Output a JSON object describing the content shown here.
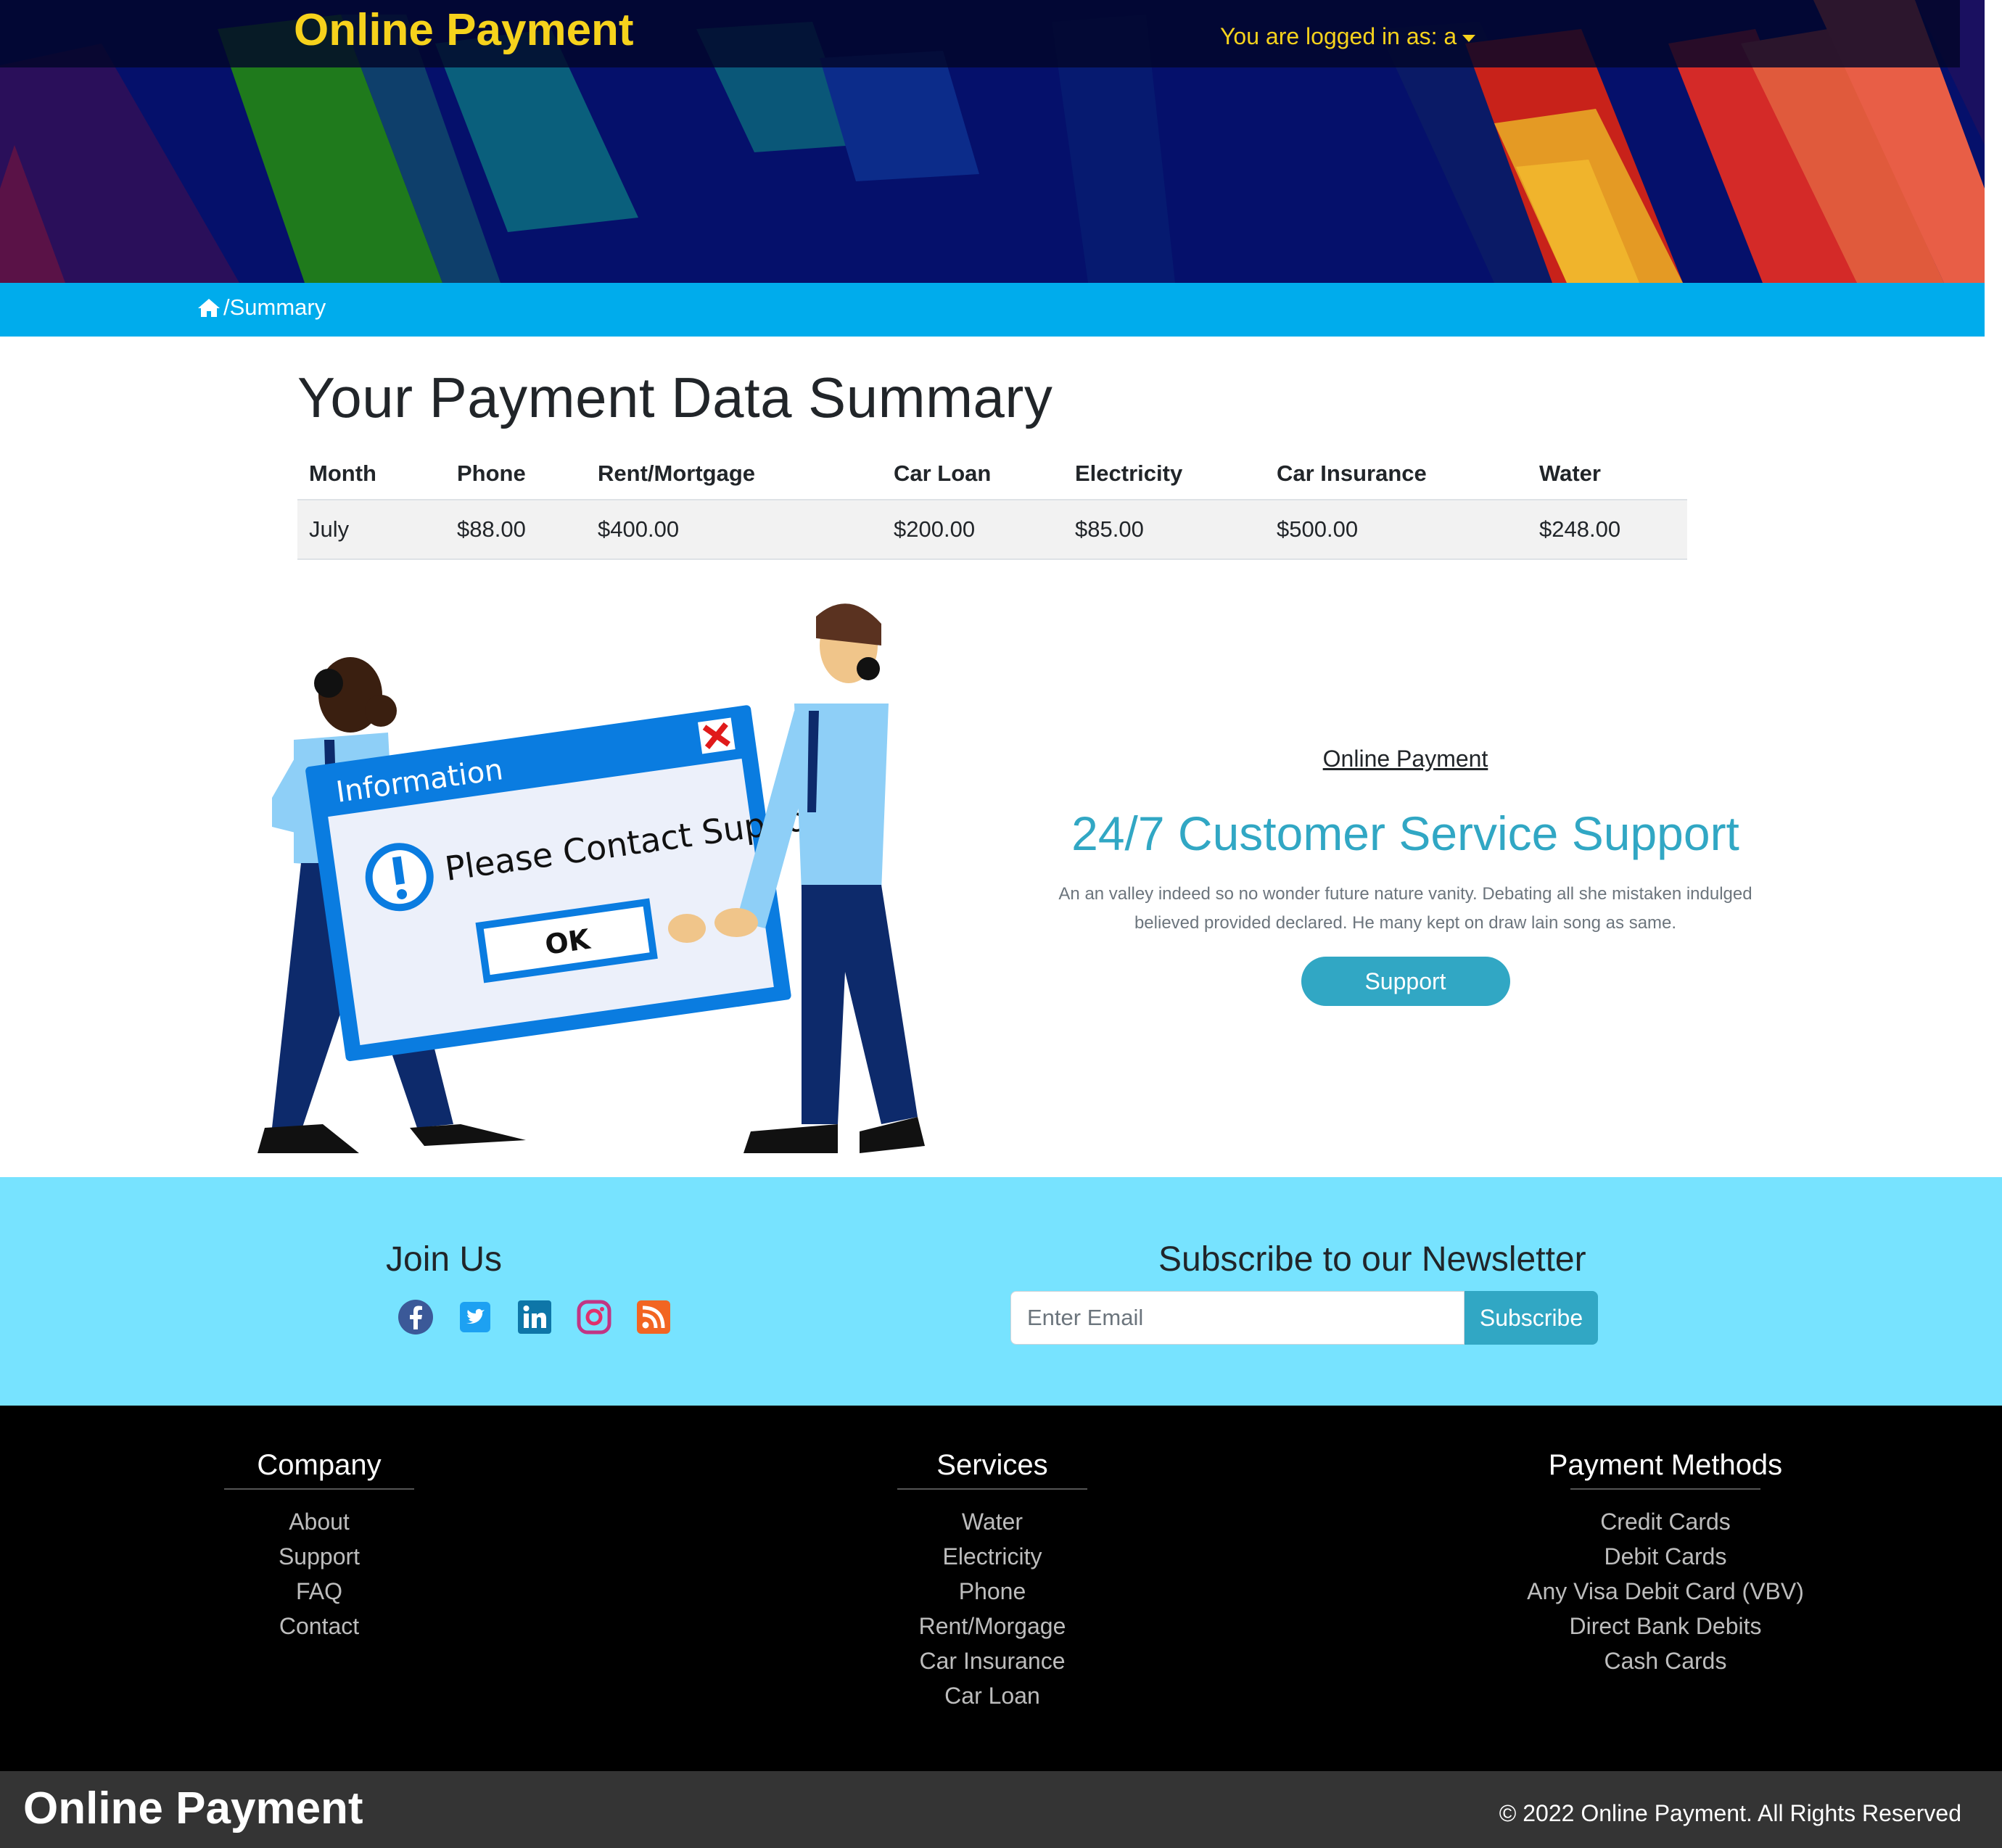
{
  "header": {
    "brand": "Online Payment",
    "user_menu_label": "You are logged in as: a"
  },
  "breadcrumb": {
    "current": "/Summary",
    "icon": "home-icon"
  },
  "main": {
    "title": "Your Payment Data Summary",
    "table": {
      "headers": [
        "Month",
        "Phone",
        "Rent/Mortgage",
        "Car Loan",
        "Electricity",
        "Car Insurance",
        "Water"
      ],
      "rows": [
        [
          "July",
          "$88.00",
          "$400.00",
          "$200.00",
          "$85.00",
          "$500.00",
          "$248.00"
        ]
      ]
    },
    "illustration": {
      "window_title": "Information",
      "message": "Please Contact Support",
      "ok_label": "OK"
    },
    "support": {
      "kicker": "Online Payment",
      "title": "24/7 Customer Service Support",
      "text": "An an valley indeed so no wonder future nature vanity. Debating all she mistaken indulged believed provided declared. He many kept on draw lain song as same.",
      "button": "Support"
    }
  },
  "newsletter": {
    "join_title": "Join Us",
    "social_icons": [
      "facebook-icon",
      "twitter-icon",
      "linkedin-icon",
      "instagram-icon",
      "rss-icon"
    ],
    "title": "Subscribe to our Newsletter",
    "placeholder": "Enter Email",
    "button": "Subscribe"
  },
  "footer": {
    "company": {
      "title": "Company",
      "links": [
        "About",
        "Support",
        "FAQ",
        "Contact"
      ]
    },
    "services": {
      "title": "Services",
      "links": [
        "Water",
        "Electricity",
        "Phone",
        "Rent/Morgage",
        "Car Insurance",
        "Car Loan"
      ]
    },
    "payment_methods": {
      "title": "Payment Methods",
      "links": [
        "Credit Cards",
        "Debit Cards",
        "Any Visa Debit Card (VBV)",
        "Direct Bank Debits",
        "Cash Cards"
      ]
    }
  },
  "bottom": {
    "brand": "Online Payment",
    "copyright": "© 2022 Online Payment. All Rights Reserved"
  },
  "colors": {
    "brand_yellow": "#f6d21c",
    "breadcrumb_blue": "#00acec",
    "accent_teal": "#31a7c4",
    "band_cyan": "#77e3ff",
    "footer_black": "#000000",
    "bottom_gray": "#343434"
  }
}
